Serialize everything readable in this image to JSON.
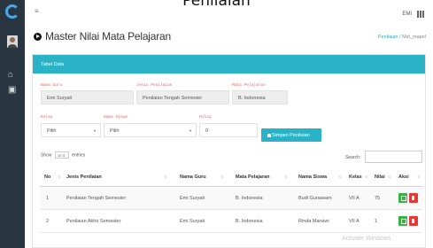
{
  "document_title": "Penilaian",
  "topbar": {
    "user": "EMI"
  },
  "page": {
    "title": "Master Nilai Mata Pelajaran"
  },
  "breadcrumb": {
    "link": "Penilaian",
    "separator": "/",
    "current": "Mst_mapel"
  },
  "card": {
    "header": "Tabel Data"
  },
  "form": {
    "nama_guru": {
      "label": "Nama Guru",
      "value": "Emi Suryati"
    },
    "jenis_penilaian": {
      "label": "Jenis Penilaian",
      "value": "Penilaian Tengah Semester"
    },
    "mata_pelajaran": {
      "label": "Mata Pelajaran",
      "value": "B. Indonesia"
    },
    "kelas": {
      "label": "Kelas",
      "value": "Pilih"
    },
    "nama_siswa": {
      "label": "Nama Siswa",
      "value": "Pilih"
    },
    "nilai": {
      "label": "Nilai",
      "value": "0"
    },
    "save_label": "Simpan Penilaian"
  },
  "table_controls": {
    "show_label": "Show",
    "entries_value": "10",
    "entries_label": "entries",
    "search_label": "Search:"
  },
  "table": {
    "headers": [
      "No",
      "Jenis Penilaian",
      "Nama Guru",
      "Mata Pelajaran",
      "Nama Siswa",
      "Kelas",
      "Nilai",
      "Aksi"
    ],
    "rows": [
      [
        "1",
        "Penilaian Tengah Semester",
        "Emi Suryati",
        "B. Indonesia",
        "Budi Gunawam",
        "VII A",
        "75"
      ],
      [
        "2",
        "Penilaian Akhir Semester",
        "Emi Suryati",
        "B. Indonesia",
        "Rinda Marsiwi",
        "VII A",
        "1"
      ]
    ]
  },
  "watermark": "Activate Windows",
  "colors": {
    "accent": "#2ab3c6",
    "sidebar": "#2a3542",
    "edit": "#3cb044",
    "delete": "#e53935"
  }
}
